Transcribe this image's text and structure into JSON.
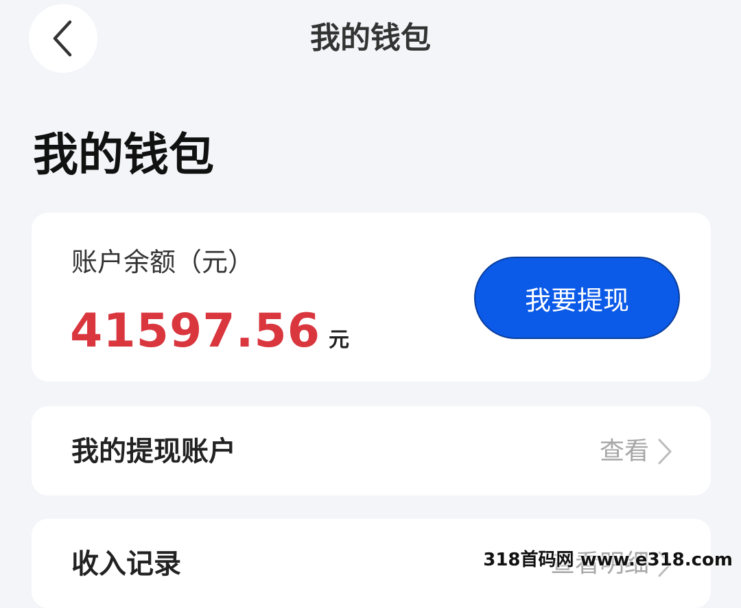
{
  "nav": {
    "back_icon": "chevron-left-icon",
    "title": "我的钱包"
  },
  "page_title": "我的钱包",
  "balance": {
    "label": "账户余额（元）",
    "amount": "41597.56",
    "unit": "元",
    "withdraw_label": "我要提现"
  },
  "rows": {
    "account": {
      "label": "我的提现账户",
      "action": "查看",
      "icon": "chevron-right-icon"
    },
    "income": {
      "label": "收入记录",
      "action": "查看明细",
      "icon": "chevron-right-icon"
    }
  },
  "watermark": "318首码网 www.e318.com",
  "colors": {
    "background": "#f3f5f9",
    "card": "#ffffff",
    "amount": "#d9363e",
    "primary_button": "#0b5ae8",
    "muted_text": "#a6a6a6"
  }
}
